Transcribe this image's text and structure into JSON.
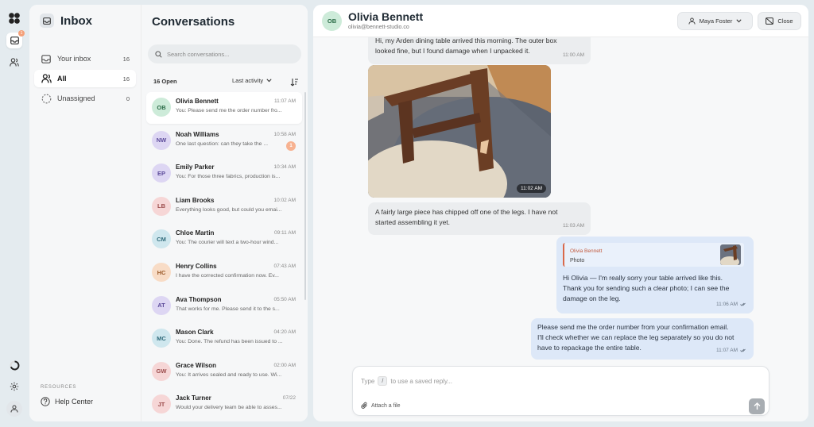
{
  "rail": {
    "badge": "1"
  },
  "inbox": {
    "title": "Inbox",
    "nav": [
      {
        "label": "Your inbox",
        "count": "16"
      },
      {
        "label": "All",
        "count": "16"
      },
      {
        "label": "Unassigned",
        "count": "0"
      }
    ],
    "resources_heading": "RESOURCES",
    "help_label": "Help Center"
  },
  "conversations": {
    "title": "Conversations",
    "search_placeholder": "Search conversations...",
    "open_count": "16 Open",
    "sort_label": "Last activity",
    "items": [
      {
        "initials": "OB",
        "name": "Olivia Bennett",
        "time": "11:07 AM",
        "preview": "You: Please send me the order number fro...",
        "bg": "#cdebd9",
        "fg": "#2a6b47",
        "badge": ""
      },
      {
        "initials": "NW",
        "name": "Noah Williams",
        "time": "10:58 AM",
        "preview": "One last question: can they take the ...",
        "bg": "#ddd6f3",
        "fg": "#5b4a9a",
        "badge": "1"
      },
      {
        "initials": "EP",
        "name": "Emily Parker",
        "time": "10:34 AM",
        "preview": "You: For those three fabrics, production is...",
        "bg": "#ddd6f3",
        "fg": "#5b4a9a",
        "badge": ""
      },
      {
        "initials": "LB",
        "name": "Liam Brooks",
        "time": "10:02 AM",
        "preview": "Everything looks good, but could you emai...",
        "bg": "#f6d6d6",
        "fg": "#9a4a4a",
        "badge": ""
      },
      {
        "initials": "CM",
        "name": "Chloe Martin",
        "time": "09:11 AM",
        "preview": "You: The courier will text a two-hour wind...",
        "bg": "#cfe7ee",
        "fg": "#2f6a7a",
        "badge": ""
      },
      {
        "initials": "HC",
        "name": "Henry Collins",
        "time": "07:43 AM",
        "preview": "I have the corrected confirmation now. Ev...",
        "bg": "#f8dcc6",
        "fg": "#9a5a2a",
        "badge": ""
      },
      {
        "initials": "AT",
        "name": "Ava Thompson",
        "time": "05:50 AM",
        "preview": "That works for me. Please send it to the s...",
        "bg": "#ddd6f3",
        "fg": "#5b4a9a",
        "badge": ""
      },
      {
        "initials": "MC",
        "name": "Mason Clark",
        "time": "04:20 AM",
        "preview": "You: Done. The refund has been issued to ...",
        "bg": "#cfe7ee",
        "fg": "#2f6a7a",
        "badge": ""
      },
      {
        "initials": "GW",
        "name": "Grace Wilson",
        "time": "02:00 AM",
        "preview": "You: It arrives sealed and ready to use. Wi...",
        "bg": "#f6d6d6",
        "fg": "#9a4a4a",
        "badge": ""
      },
      {
        "initials": "JT",
        "name": "Jack Turner",
        "time": "07/22",
        "preview": "Would your delivery team be able to asses...",
        "bg": "#f6d6d6",
        "fg": "#9a4a4a",
        "badge": ""
      }
    ]
  },
  "chat": {
    "contact_initials": "OB",
    "contact_name": "Olivia Bennett",
    "contact_email": "olivia@bennett-studio.co",
    "assignee": "Maya Foster",
    "close_label": "Close",
    "messages": [
      {
        "line1": "Hi, my Arden dining table arrived this morning. The outer box",
        "line2": "looked fine, but I found damage when I unpacked it.",
        "time": "11:00 AM"
      },
      {
        "photo_time": "11:02 AM"
      },
      {
        "line1": "A fairly large piece has chipped off one of the legs. I have not",
        "line2": "started assembling it yet.",
        "time": "11:03 AM"
      },
      {
        "quote_name": "Olivia Bennett",
        "quote_type": "Photo",
        "line1": "Hi Olivia — I'm really sorry your table arrived like this.",
        "line2": "Thank you for sending such a clear photo; I can see the",
        "line3": "damage on the leg.",
        "time": "11:06 AM"
      },
      {
        "line1": "Please send me the order number from your confirmation email.",
        "line2": "I'll check whether we can replace the leg separately so you do not",
        "line3": "have to repackage the entire table.",
        "time": "11:07 AM"
      }
    ]
  },
  "composer": {
    "hint_prefix": "Type",
    "hint_key": "/",
    "hint_suffix": "to use a saved reply...",
    "attach_label": "Attach a file"
  }
}
